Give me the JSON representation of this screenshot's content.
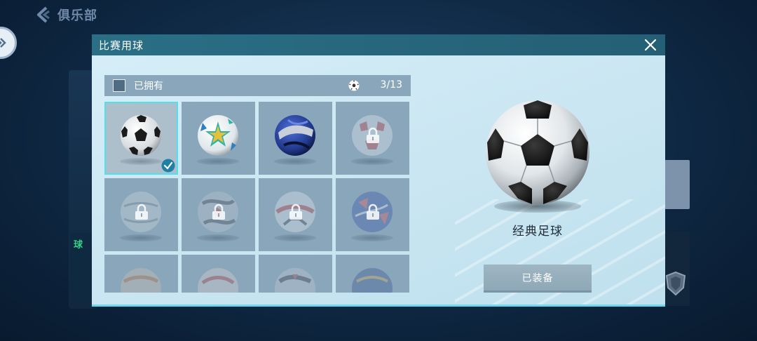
{
  "background": {
    "title": "俱乐部",
    "side_tag": "球"
  },
  "modal": {
    "title": "比赛用球",
    "filter": {
      "label": "已拥有",
      "checked": false,
      "count": "3/13"
    },
    "grid": [
      {
        "name": "classic-ball",
        "locked": false,
        "selected": true
      },
      {
        "name": "star-ball",
        "locked": false,
        "selected": false
      },
      {
        "name": "blue-ball",
        "locked": false,
        "selected": false
      },
      {
        "name": "red-pattern-ball",
        "locked": true,
        "selected": false
      },
      {
        "name": "ball-5",
        "locked": true,
        "selected": false
      },
      {
        "name": "ball-6",
        "locked": true,
        "selected": false
      },
      {
        "name": "ball-7",
        "locked": true,
        "selected": false
      },
      {
        "name": "ball-8",
        "locked": true,
        "selected": false
      },
      {
        "name": "ball-9",
        "locked": true,
        "selected": false
      },
      {
        "name": "ball-10",
        "locked": true,
        "selected": false
      },
      {
        "name": "ball-11",
        "locked": true,
        "selected": false
      },
      {
        "name": "ball-12",
        "locked": true,
        "selected": false
      }
    ],
    "preview": {
      "name": "经典足球",
      "button_label": "已装备"
    }
  },
  "colors": {
    "header": "#2a6f86",
    "panel": "#cfe9f5",
    "cell": "#8aa6bb",
    "selected_outline": "#53e0ee",
    "button": "#97afbd"
  }
}
